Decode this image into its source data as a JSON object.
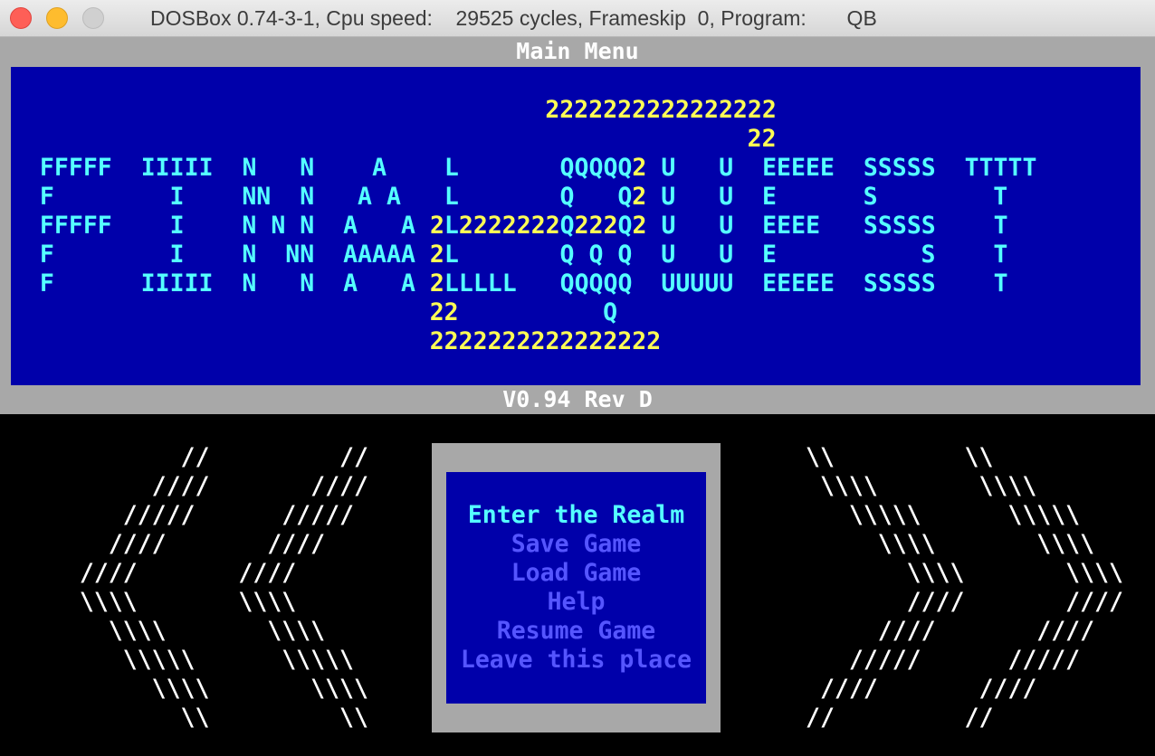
{
  "window": {
    "title": "DOSBox 0.74-3-1, Cpu speed:    29525 cycles, Frameskip  0, Program:       QB"
  },
  "screen": {
    "heading": "Main Menu",
    "version": "V0.94 Rev D",
    "art_lines": [
      "                                     2222222222222222",
      "                                                   22",
      "  FFFFF  IIIII  N   N    A    L       QQQQQ2 U   U  EEEEE  SSSSS  TTTTT",
      "  F        I    NN  N   A A   L       Q   Q2 U   U  E      S        T",
      "  FFFFF    I    N N N  A   A 2L2222222Q222Q2 U   U  EEEE   SSSSS    T",
      "  F        I    N  NN  AAAAA 2L       Q Q Q  U   U  E          S    T",
      "  F      IIIII  N   N  A   A 2LLLLL   QQQQQ  UUUUU  EEEEE  SSSSS    T",
      "                             22          Q",
      "                             2222222222222222"
    ],
    "left_arrows": [
      "          //         //",
      "        ////       ////",
      "      /////      /////",
      "     ////       ////",
      "   ////       ////",
      "   \\\\\\\\       \\\\\\\\",
      "     \\\\\\\\       \\\\\\\\",
      "      \\\\\\\\\\      \\\\\\\\\\",
      "        \\\\\\\\       \\\\\\\\",
      "          \\\\         \\\\"
    ],
    "right_arrows": [
      "\\\\         \\\\",
      " \\\\\\\\       \\\\\\\\",
      "   \\\\\\\\\\      \\\\\\\\\\",
      "     \\\\\\\\       \\\\\\\\",
      "       \\\\\\\\       \\\\\\\\",
      "       ////       ////",
      "     ////       ////",
      "   /////      /////",
      " ////       ////",
      "//         //"
    ]
  },
  "menu": {
    "items": [
      {
        "label": "Enter the Realm",
        "selected": true
      },
      {
        "label": "Save Game",
        "selected": false
      },
      {
        "label": "Load Game",
        "selected": false
      },
      {
        "label": "Help",
        "selected": false
      },
      {
        "label": "Resume Game",
        "selected": false
      },
      {
        "label": "Leave this place",
        "selected": false
      }
    ]
  },
  "colors": {
    "banner_bg": "#0000aa",
    "frame": "#a8a8a8",
    "cyan": "#55ffff",
    "yellow": "#ffff55",
    "menu_dim": "#5555ff"
  }
}
